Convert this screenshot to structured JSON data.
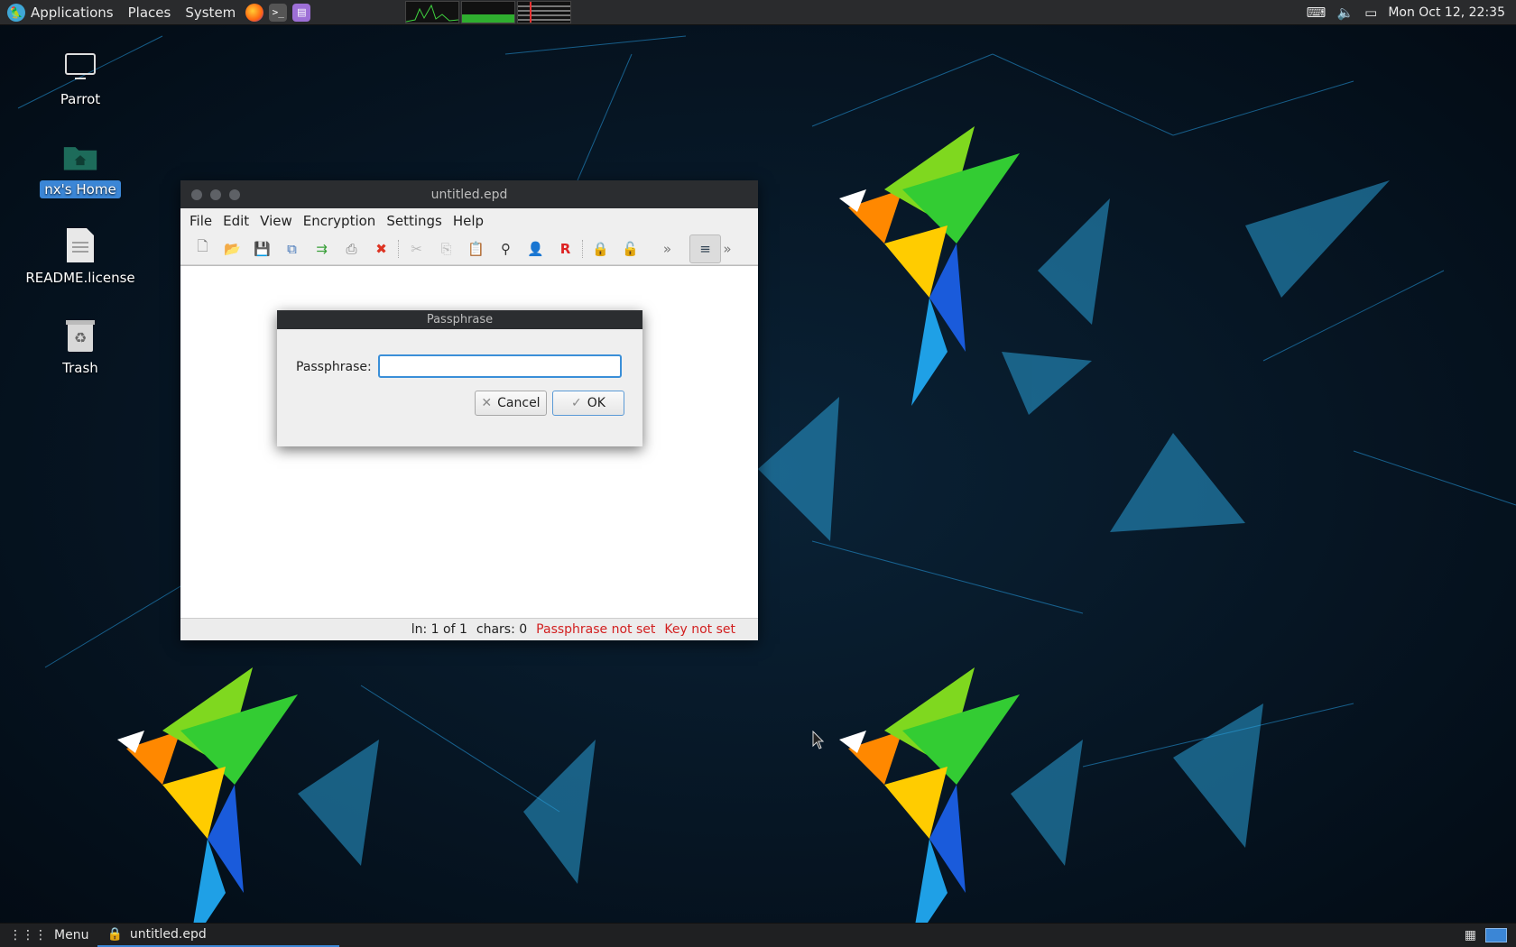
{
  "top_panel": {
    "applications": "Applications",
    "places": "Places",
    "system": "System",
    "clock": "Mon Oct 12, 22:35"
  },
  "desktop_icons": [
    {
      "label": "Parrot",
      "icon": "computer-icon"
    },
    {
      "label": "nx's Home",
      "icon": "home-folder-icon"
    },
    {
      "label": "README.license",
      "icon": "text-file-icon"
    },
    {
      "label": "Trash",
      "icon": "trash-icon"
    }
  ],
  "editor": {
    "title": "untitled.epd",
    "menu": [
      "File",
      "Edit",
      "View",
      "Encryption",
      "Settings",
      "Help"
    ],
    "status": {
      "position": "ln: 1 of 1",
      "chars": "chars: 0",
      "passphrase_state": "Passphrase not set",
      "key_state": "Key not set"
    },
    "warn_color": "#d21f1f"
  },
  "dialog": {
    "title": "Passphrase",
    "label": "Passphrase:",
    "input_value": "",
    "cancel": "Cancel",
    "ok": "OK"
  },
  "bottom_panel": {
    "menu": "Menu",
    "task": "untitled.epd"
  },
  "colors": {
    "accent": "#3b86d6",
    "panel": "#2a2b2d"
  }
}
